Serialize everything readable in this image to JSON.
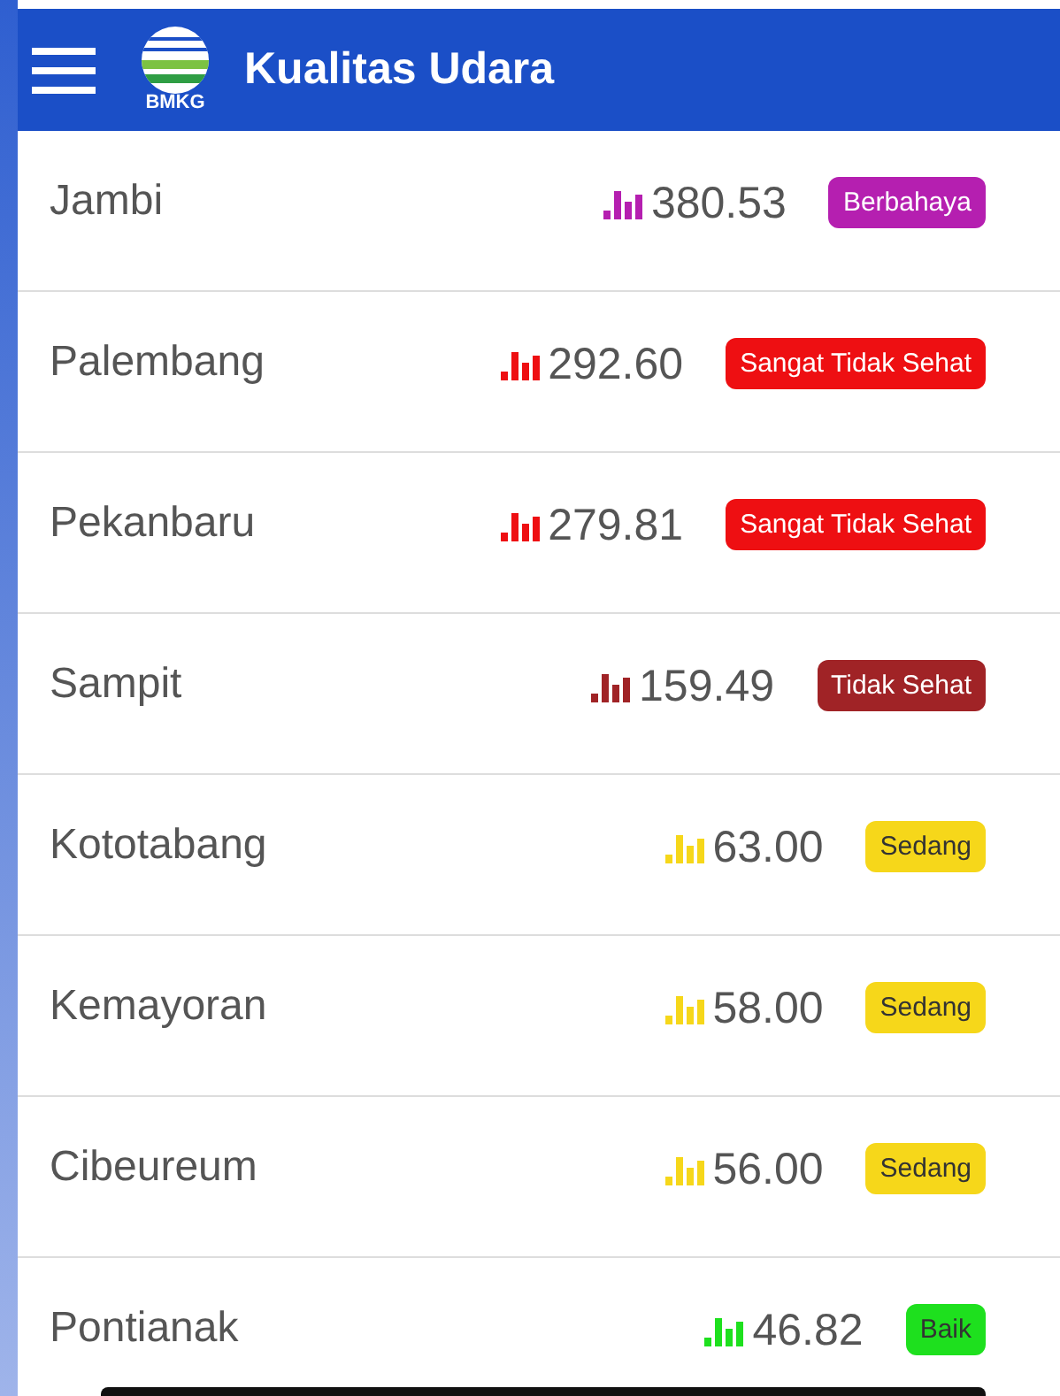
{
  "header": {
    "title": "Kualitas Udara",
    "logo_text": "BMKG"
  },
  "stations": [
    {
      "name": "Jambi",
      "value": "380.53",
      "status": "Berbahaya",
      "color": "#b51fb0",
      "text_dark": false
    },
    {
      "name": "Palembang",
      "value": "292.60",
      "status": "Sangat Tidak Sehat",
      "color": "#ee0f12",
      "text_dark": false
    },
    {
      "name": "Pekanbaru",
      "value": "279.81",
      "status": "Sangat Tidak Sehat",
      "color": "#ee0f12",
      "text_dark": false
    },
    {
      "name": "Sampit",
      "value": "159.49",
      "status": "Tidak Sehat",
      "color": "#a02326",
      "text_dark": false
    },
    {
      "name": "Kototabang",
      "value": "63.00",
      "status": "Sedang",
      "color": "#f6d71a",
      "text_dark": true
    },
    {
      "name": "Kemayoran",
      "value": "58.00",
      "status": "Sedang",
      "color": "#f6d71a",
      "text_dark": true
    },
    {
      "name": "Cibeureum",
      "value": "56.00",
      "status": "Sedang",
      "color": "#f6d71a",
      "text_dark": true
    },
    {
      "name": "Pontianak",
      "value": "46.82",
      "status": "Baik",
      "color": "#1ee01e",
      "text_dark": true
    }
  ]
}
